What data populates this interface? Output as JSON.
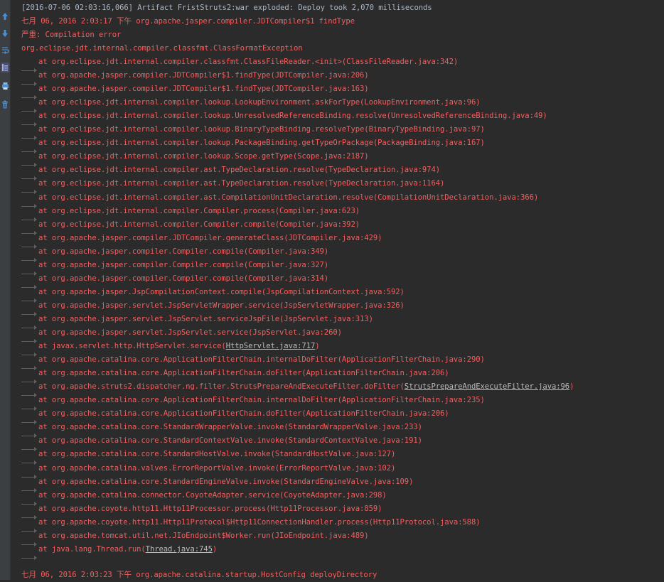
{
  "toolbar_icons": [
    "up-arrow-icon",
    "down-arrow-icon",
    "soft-wrap-icon",
    "scroll-to-end-icon",
    "print-icon",
    "trash-icon"
  ],
  "colors": {
    "background": "#2b2b2b",
    "error_text": "#f15f5f",
    "normal_text": "#a9b7c6",
    "gutter": "#3c3f41"
  },
  "console": {
    "top_line": "[2016-07-06 02:03:16,066] Artifact FristStruts2:war exploded: Deploy took 2,070 milliseconds",
    "header1": "七月 06, 2016 2:03:17 下午 org.apache.jasper.compiler.JDTCompiler$1 findType",
    "severity": "严重: Compilation error",
    "exception": "org.eclipse.jdt.internal.compiler.classfmt.ClassFormatException",
    "frames": [
      {
        "text": "at org.eclipse.jdt.internal.compiler.classfmt.ClassFileReader.<init>(ClassFileReader.java:342)"
      },
      {
        "text": "at org.apache.jasper.compiler.JDTCompiler$1.findType(JDTCompiler.java:206)"
      },
      {
        "text": "at org.apache.jasper.compiler.JDTCompiler$1.findType(JDTCompiler.java:163)"
      },
      {
        "text": "at org.eclipse.jdt.internal.compiler.lookup.LookupEnvironment.askForType(LookupEnvironment.java:96)"
      },
      {
        "text": "at org.eclipse.jdt.internal.compiler.lookup.UnresolvedReferenceBinding.resolve(UnresolvedReferenceBinding.java:49)"
      },
      {
        "text": "at org.eclipse.jdt.internal.compiler.lookup.BinaryTypeBinding.resolveType(BinaryTypeBinding.java:97)"
      },
      {
        "text": "at org.eclipse.jdt.internal.compiler.lookup.PackageBinding.getTypeOrPackage(PackageBinding.java:167)"
      },
      {
        "text": "at org.eclipse.jdt.internal.compiler.lookup.Scope.getType(Scope.java:2187)"
      },
      {
        "text": "at org.eclipse.jdt.internal.compiler.ast.TypeDeclaration.resolve(TypeDeclaration.java:974)"
      },
      {
        "text": "at org.eclipse.jdt.internal.compiler.ast.TypeDeclaration.resolve(TypeDeclaration.java:1164)"
      },
      {
        "text": "at org.eclipse.jdt.internal.compiler.ast.CompilationUnitDeclaration.resolve(CompilationUnitDeclaration.java:366)"
      },
      {
        "text": "at org.eclipse.jdt.internal.compiler.Compiler.process(Compiler.java:623)"
      },
      {
        "text": "at org.eclipse.jdt.internal.compiler.Compiler.compile(Compiler.java:392)"
      },
      {
        "text": "at org.apache.jasper.compiler.JDTCompiler.generateClass(JDTCompiler.java:429)"
      },
      {
        "text": "at org.apache.jasper.compiler.Compiler.compile(Compiler.java:349)"
      },
      {
        "text": "at org.apache.jasper.compiler.Compiler.compile(Compiler.java:327)"
      },
      {
        "text": "at org.apache.jasper.compiler.Compiler.compile(Compiler.java:314)"
      },
      {
        "text": "at org.apache.jasper.JspCompilationContext.compile(JspCompilationContext.java:592)"
      },
      {
        "text": "at org.apache.jasper.servlet.JspServletWrapper.service(JspServletWrapper.java:326)"
      },
      {
        "text": "at org.apache.jasper.servlet.JspServlet.serviceJspFile(JspServlet.java:313)"
      },
      {
        "text": "at org.apache.jasper.servlet.JspServlet.service(JspServlet.java:260)"
      },
      {
        "text": "at javax.servlet.http.HttpServlet.service(",
        "link": "HttpServlet.java:717",
        "tail": ")"
      },
      {
        "text": "at org.apache.catalina.core.ApplicationFilterChain.internalDoFilter(ApplicationFilterChain.java:290)"
      },
      {
        "text": "at org.apache.catalina.core.ApplicationFilterChain.doFilter(ApplicationFilterChain.java:206)"
      },
      {
        "text": "at org.apache.struts2.dispatcher.ng.filter.StrutsPrepareAndExecuteFilter.doFilter(",
        "link": "StrutsPrepareAndExecuteFilter.java:96",
        "tail": ")"
      },
      {
        "text": "at org.apache.catalina.core.ApplicationFilterChain.internalDoFilter(ApplicationFilterChain.java:235)"
      },
      {
        "text": "at org.apache.catalina.core.ApplicationFilterChain.doFilter(ApplicationFilterChain.java:206)"
      },
      {
        "text": "at org.apache.catalina.core.StandardWrapperValve.invoke(StandardWrapperValve.java:233)"
      },
      {
        "text": "at org.apache.catalina.core.StandardContextValve.invoke(StandardContextValve.java:191)"
      },
      {
        "text": "at org.apache.catalina.core.StandardHostValve.invoke(StandardHostValve.java:127)"
      },
      {
        "text": "at org.apache.catalina.valves.ErrorReportValve.invoke(ErrorReportValve.java:102)"
      },
      {
        "text": "at org.apache.catalina.core.StandardEngineValve.invoke(StandardEngineValve.java:109)"
      },
      {
        "text": "at org.apache.catalina.connector.CoyoteAdapter.service(CoyoteAdapter.java:298)"
      },
      {
        "text": "at org.apache.coyote.http11.Http11Processor.process(Http11Processor.java:859)"
      },
      {
        "text": "at org.apache.coyote.http11.Http11Protocol$Http11ConnectionHandler.process(Http11Protocol.java:588)"
      },
      {
        "text": "at org.apache.tomcat.util.net.JIoEndpoint$Worker.run(JIoEndpoint.java:489)"
      },
      {
        "text": "at java.lang.Thread.run(",
        "link": "Thread.java:745",
        "tail": ")"
      }
    ],
    "header2": "七月 06, 2016 2:03:23 下午 org.apache.catalina.startup.HostConfig deployDirectory"
  }
}
